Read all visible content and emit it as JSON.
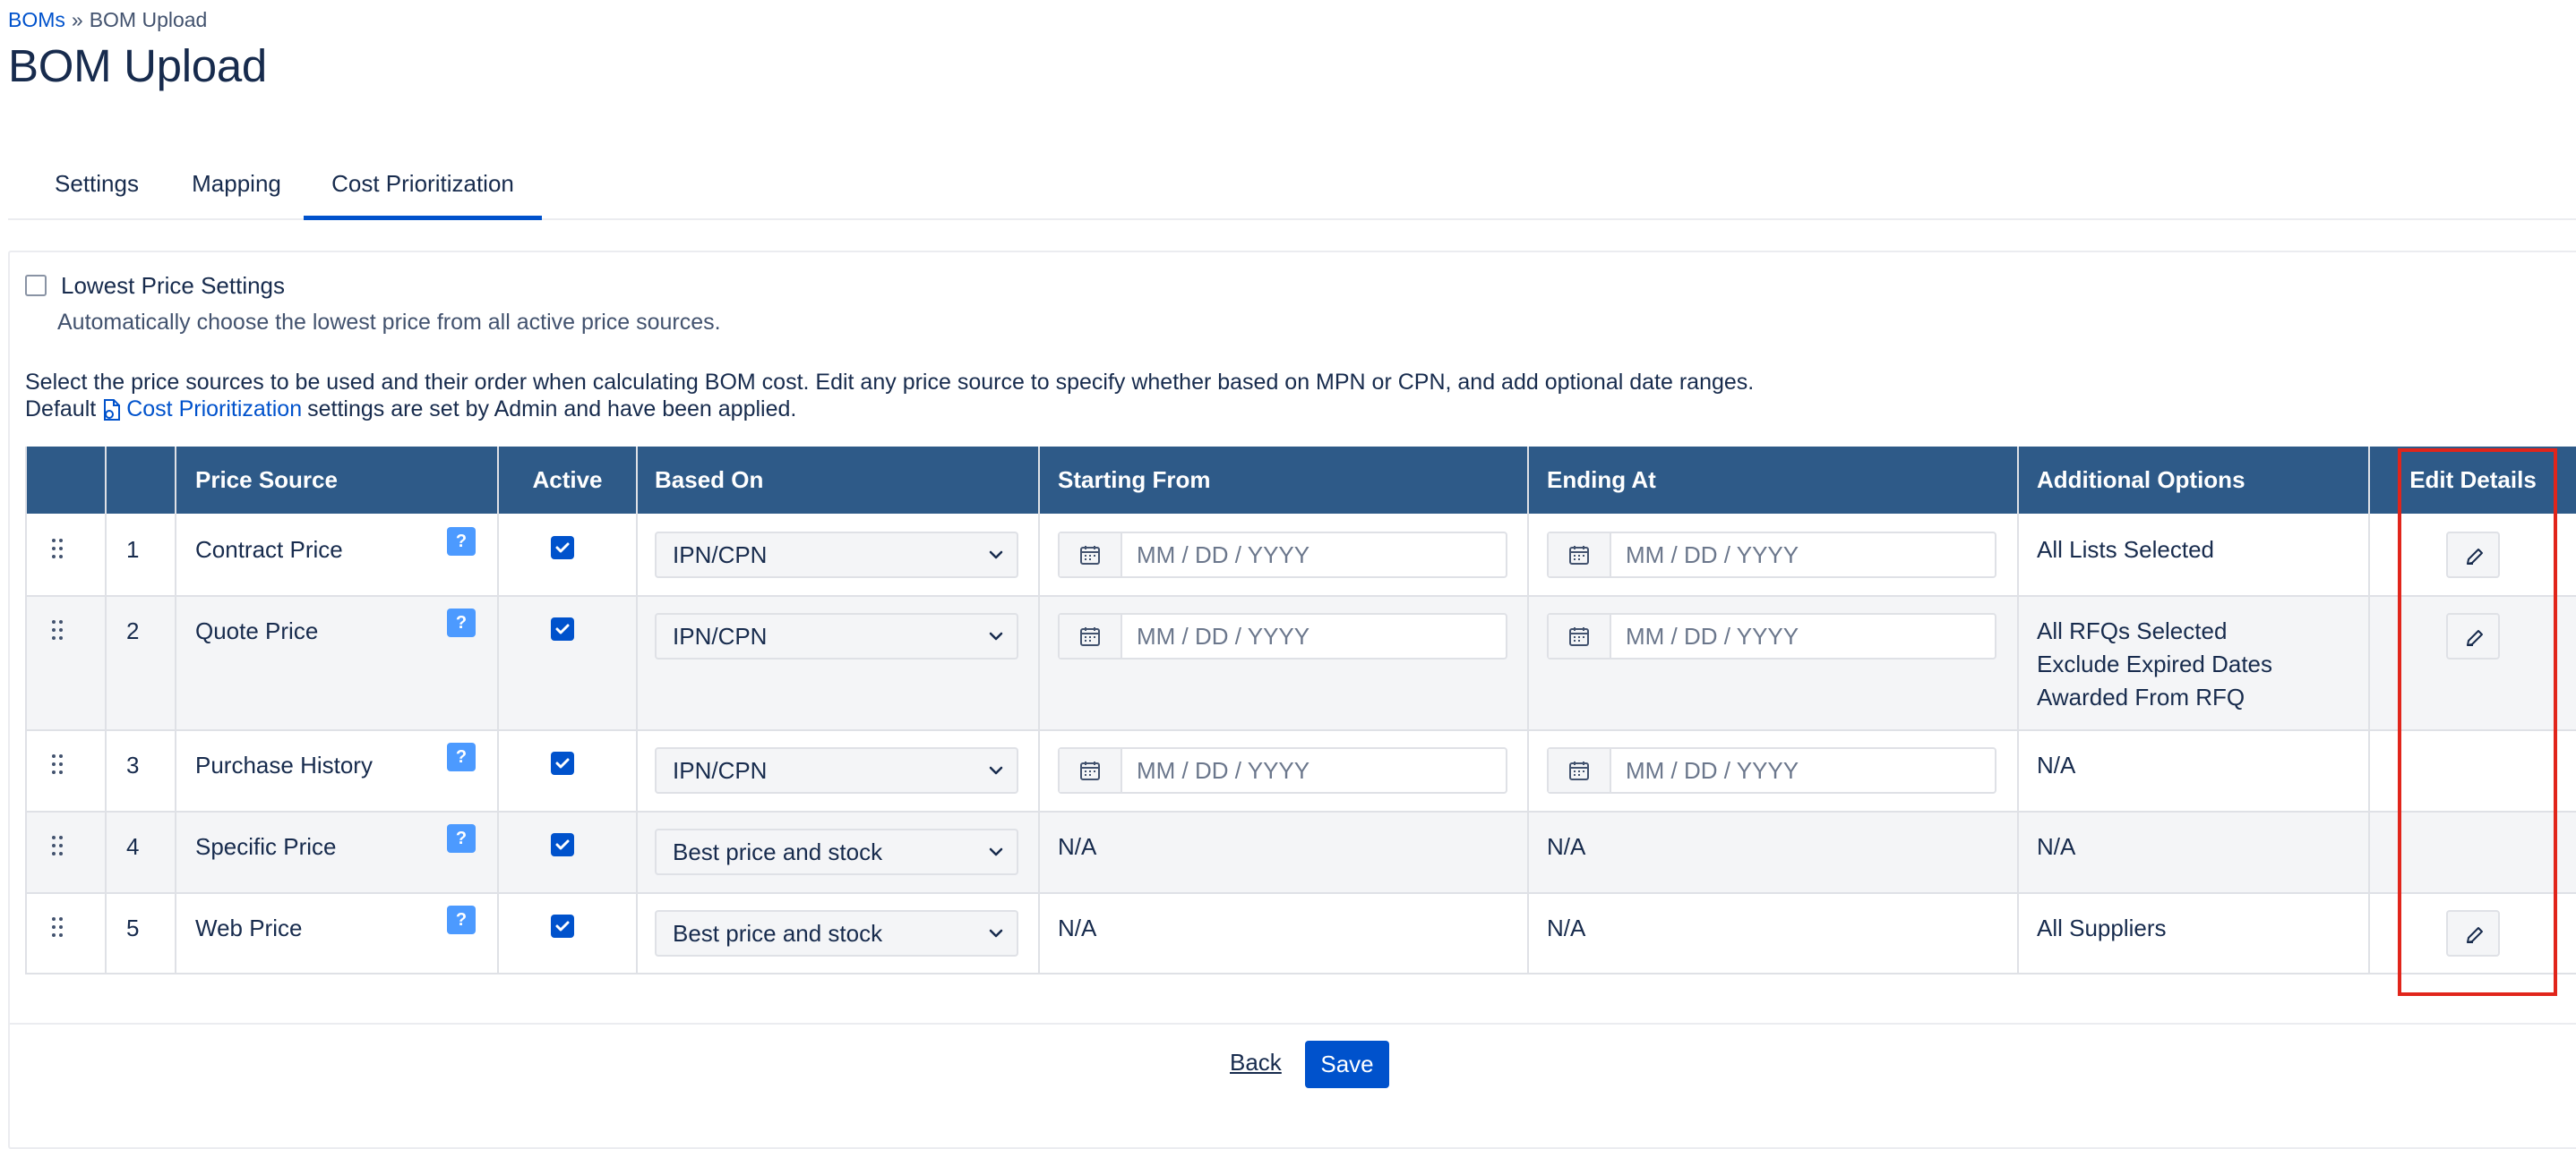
{
  "breadcrumb": {
    "parent": "BOMs",
    "separator": "»",
    "current": "BOM Upload"
  },
  "page_title": "BOM Upload",
  "tabs": [
    {
      "label": "Settings",
      "active": false
    },
    {
      "label": "Mapping",
      "active": false
    },
    {
      "label": "Cost Prioritization",
      "active": true
    }
  ],
  "lowest_price": {
    "label": "Lowest Price Settings",
    "checked": false,
    "description": "Automatically choose the lowest price from all active price sources."
  },
  "info": {
    "line1": "Select the price sources to be used and their order when calculating BOM cost. Edit any price source to specify whether based on MPN or CPN, and add optional date ranges.",
    "line2_prefix": "Default",
    "line2_link": "Cost Prioritization",
    "line2_suffix": "settings are set by Admin and have been applied."
  },
  "table": {
    "headers": {
      "price_source": "Price Source",
      "active": "Active",
      "based_on": "Based On",
      "starting_from": "Starting From",
      "ending_at": "Ending At",
      "additional_options": "Additional Options",
      "edit_details": "Edit Details"
    },
    "help_label": "?",
    "date_placeholder": "MM / DD / YYYY",
    "rows": [
      {
        "num": "1",
        "source": "Contract Price",
        "active": true,
        "based_on": "IPN/CPN",
        "start": "",
        "end": "",
        "options": [
          "All Lists Selected"
        ],
        "editable": true
      },
      {
        "num": "2",
        "source": "Quote Price",
        "active": true,
        "based_on": "IPN/CPN",
        "start": "",
        "end": "",
        "options": [
          "All RFQs Selected",
          "Exclude Expired Dates",
          "Awarded From RFQ"
        ],
        "editable": true
      },
      {
        "num": "3",
        "source": "Purchase History",
        "active": true,
        "based_on": "IPN/CPN",
        "start": "",
        "end": "",
        "options": [
          "N/A"
        ],
        "editable": false
      },
      {
        "num": "4",
        "source": "Specific Price",
        "active": true,
        "based_on": "Best price and stock",
        "start": "N/A",
        "end": "N/A",
        "options": [
          "N/A"
        ],
        "editable": false
      },
      {
        "num": "5",
        "source": "Web Price",
        "active": true,
        "based_on": "Best price and stock",
        "start": "N/A",
        "end": "N/A",
        "options": [
          "All Suppliers"
        ],
        "editable": true
      }
    ]
  },
  "actions": {
    "back": "Back",
    "save": "Save"
  },
  "colors": {
    "header_bg": "#2e5a88",
    "accent": "#0052cc",
    "help_bg": "#4c9aff",
    "highlight": "#e1251b"
  }
}
